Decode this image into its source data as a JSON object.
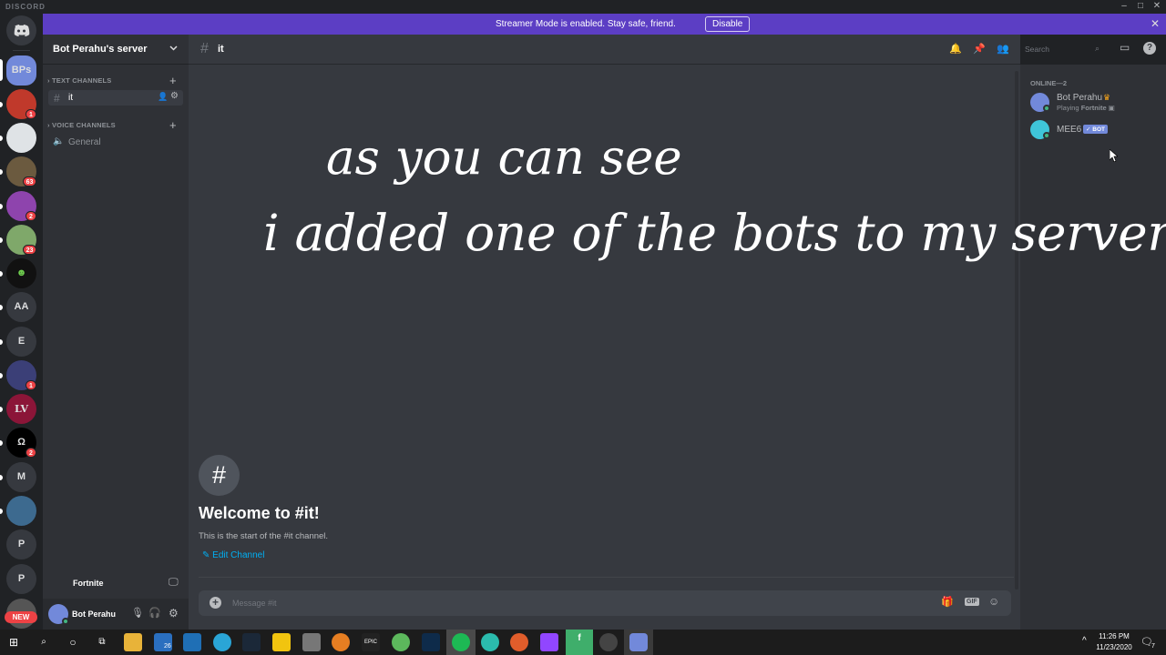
{
  "app": {
    "brand": "DISCORD"
  },
  "banner": {
    "message": "Streamer Mode is enabled. Stay safe, friend.",
    "button": "Disable"
  },
  "guilds": {
    "selected_initials": "BPs",
    "items": [
      {
        "initials": "",
        "badge": "1",
        "icon": "among-us-icon"
      },
      {
        "initials": "",
        "badge": "",
        "icon": "circle-logo-icon"
      },
      {
        "initials": "",
        "badge": "63",
        "icon": "monkey-icon"
      },
      {
        "initials": "",
        "badge": "2",
        "icon": "pink-avatar-icon"
      },
      {
        "initials": "",
        "badge": "23",
        "icon": "landscape-icon"
      },
      {
        "initials": "",
        "badge": "",
        "icon": "alien-icon"
      },
      {
        "initials": "AA",
        "badge": ""
      },
      {
        "initials": "E",
        "badge": ""
      },
      {
        "initials": "",
        "badge": "1",
        "icon": "esports-icon"
      },
      {
        "initials": "",
        "badge": "",
        "icon": "lv-icon"
      },
      {
        "initials": "Ω",
        "badge": "2"
      },
      {
        "initials": "M",
        "badge": ""
      },
      {
        "initials": "",
        "badge": "",
        "icon": "wave-icon"
      },
      {
        "initials": "P",
        "badge": ""
      },
      {
        "initials": "P",
        "badge": ""
      }
    ],
    "new_label": "NEW"
  },
  "server": {
    "name": "Bot Perahu's server",
    "text_category": "TEXT CHANNELS",
    "voice_category": "VOICE CHANNELS",
    "text_channel": "it",
    "voice_channel": "General"
  },
  "activity": {
    "game": "Fortnite"
  },
  "user": {
    "name": "Bot Perahu"
  },
  "header": {
    "channel": "it",
    "search_placeholder": "Search"
  },
  "members": {
    "heading": "ONLINE—2",
    "list": [
      {
        "name": "Bot Perahu",
        "status_prefix": "Playing",
        "status_game": "Fortnite"
      },
      {
        "name": "MEE6",
        "tag": "✓ BOT"
      }
    ]
  },
  "overlay": {
    "line1": "as you can see",
    "line2": "i added one of the bots to my server"
  },
  "welcome": {
    "hash": "#",
    "title": "Welcome to #it!",
    "subtitle": "This is the start of the #it channel.",
    "edit": "Edit Channel"
  },
  "composer": {
    "placeholder": "Message #it",
    "gif": "GIF"
  },
  "taskbar": {
    "time": "11:26 PM",
    "date": "11/23/2020",
    "mail_count": "26",
    "notif_count": "7"
  },
  "colors": {
    "blurple": "#7289da",
    "banner": "#5c3ec4",
    "online": "#43b581",
    "link": "#00b0f4"
  }
}
